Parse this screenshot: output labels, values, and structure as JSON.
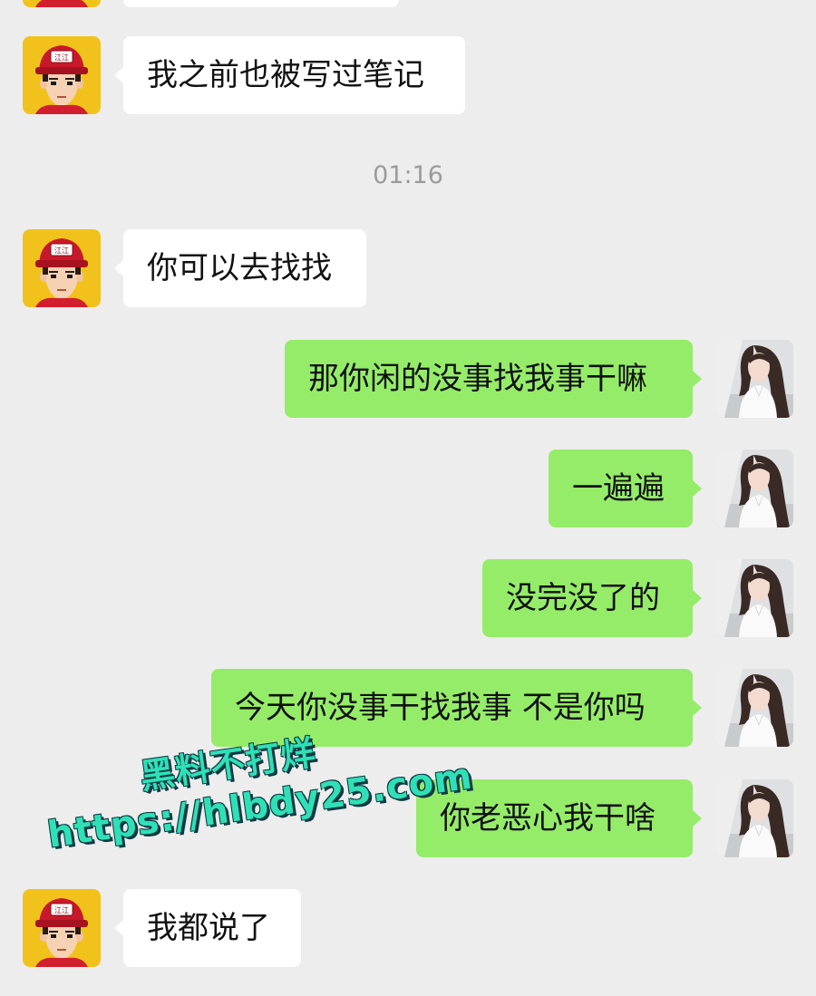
{
  "chat": {
    "timestamp": "01:16",
    "messages": [
      {
        "side": "left",
        "text": ""
      },
      {
        "side": "left",
        "text": "我之前也被写过笔记"
      },
      {
        "side": "left",
        "text": "你可以去找找"
      },
      {
        "side": "right",
        "text": "那你闲的没事找我事干嘛"
      },
      {
        "side": "right",
        "text": "一遍遍"
      },
      {
        "side": "right",
        "text": "没完没了的"
      },
      {
        "side": "right",
        "text": "今天你没事干找我事 不是你吗"
      },
      {
        "side": "right",
        "text": "你老恶心我干啥"
      },
      {
        "side": "left",
        "text": "我都说了"
      }
    ],
    "left_avatar_badge": "江江"
  },
  "watermark": {
    "line1": "黑料不打烊",
    "line2": "https://hlbdy25.com"
  },
  "colors": {
    "background": "#ededed",
    "bubble_left": "#ffffff",
    "bubble_right": "#95ec69",
    "timestamp": "#9b9b9b",
    "watermark": "#2fe0b6"
  }
}
